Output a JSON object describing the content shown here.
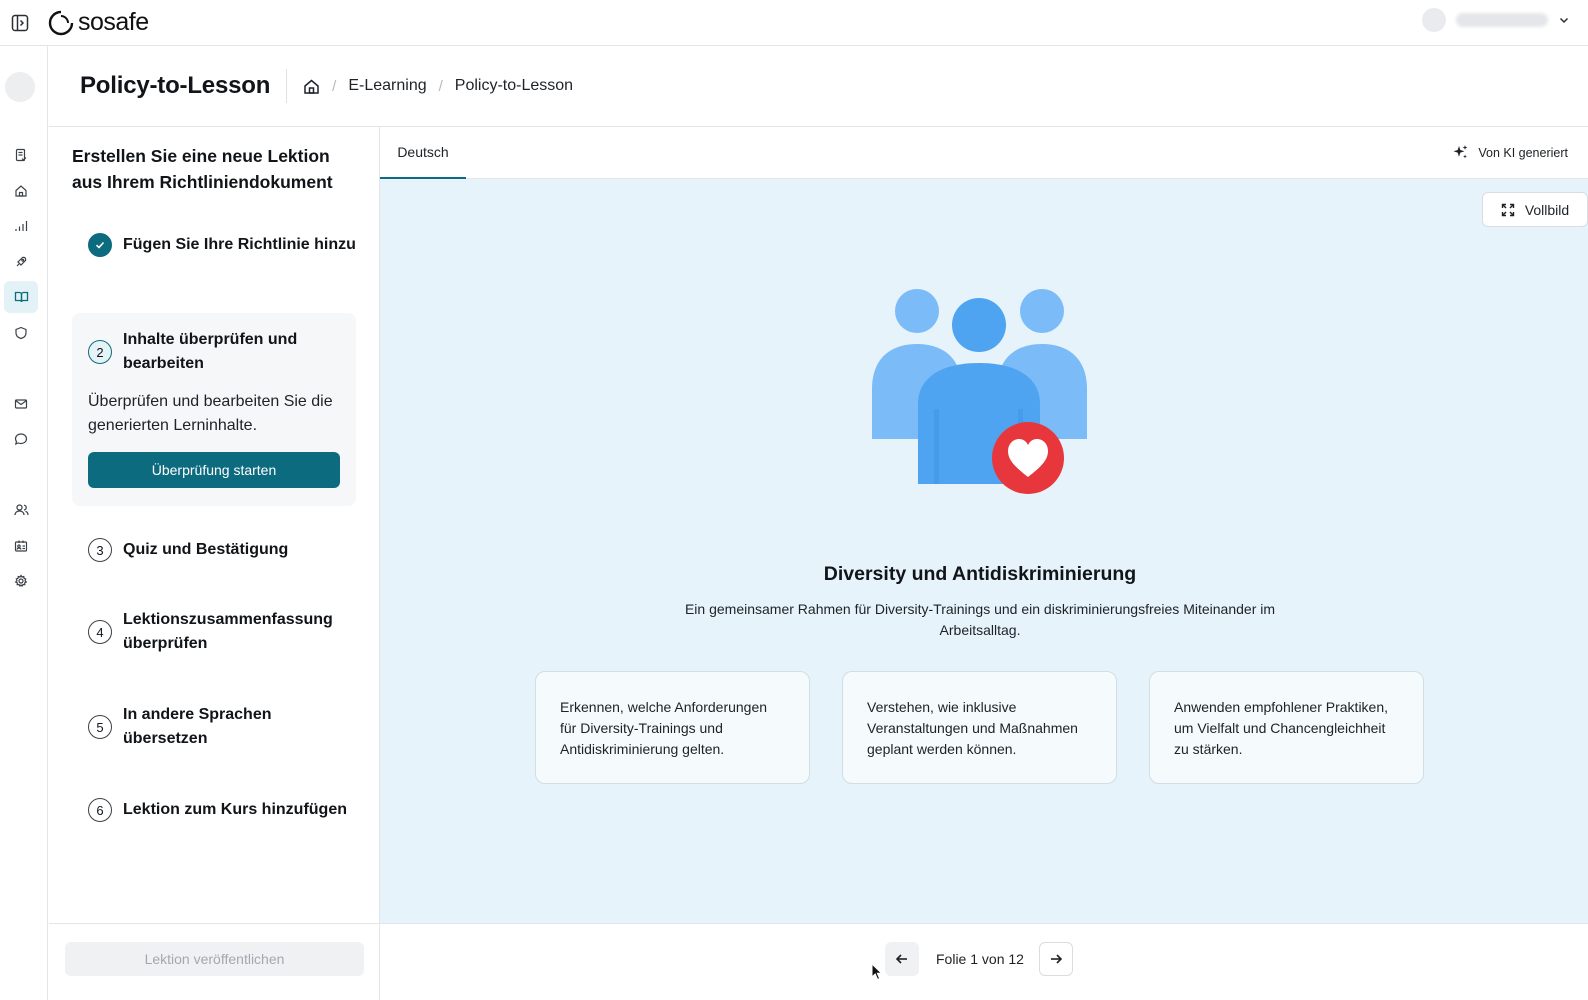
{
  "app": {
    "logo_text": "sosafe"
  },
  "header": {
    "title": "Policy-to-Lesson",
    "breadcrumb": [
      "E-Learning",
      "Policy-to-Lesson"
    ]
  },
  "steps": {
    "title": "Erstellen Sie eine neue Lektion aus Ihrem Richtliniendokument",
    "items": [
      {
        "num": "1",
        "label": "Fügen Sie Ihre Richtlinie hinzu",
        "state": "done"
      },
      {
        "num": "2",
        "label": "Inhalte überprüfen und bearbeiten",
        "state": "current",
        "description": "Überprüfen und bearbeiten Sie die generierten Lerninhalte.",
        "button": "Überprüfung starten"
      },
      {
        "num": "3",
        "label": "Quiz und Bestätigung",
        "state": "todo"
      },
      {
        "num": "4",
        "label": "Lektionszusammenfassung überprüfen",
        "state": "todo"
      },
      {
        "num": "5",
        "label": "In andere Sprachen übersetzen",
        "state": "todo"
      },
      {
        "num": "6",
        "label": "Lektion zum Kurs hinzufügen",
        "state": "todo"
      }
    ],
    "publish_button": "Lektion veröffentlichen"
  },
  "tabs": {
    "active": "Deutsch",
    "ai_label": "Von KI generiert"
  },
  "slide": {
    "fullscreen_label": "Vollbild",
    "title": "Diversity und Antidiskriminierung",
    "subtitle": "Ein gemeinsamer Rahmen für Diversity-Trainings und ein diskriminierungsfreies Miteinander im Arbeitsalltag.",
    "cards": [
      "Erkennen, welche Anforderungen für Diversity-Trainings und Antidiskriminierung gelten.",
      "Verstehen, wie inklusive Veranstaltungen und Maßnahmen geplant werden können.",
      "Anwenden empfohlener Praktiken, um Vielfalt und Chancengleichheit zu stärken."
    ]
  },
  "pager": {
    "text": "Folie 1 von 12"
  },
  "colors": {
    "accent": "#0d6b7f",
    "slide_bg": "#e6f3fb",
    "people": "#6fb4f5",
    "heart": "#e8363d"
  },
  "icons": {
    "rail": [
      "document-icon",
      "home-icon",
      "chart-icon",
      "rocket-icon",
      "book-icon",
      "shield-icon",
      "mail-icon",
      "chat-icon",
      "users-icon",
      "id-card-icon",
      "gear-icon"
    ]
  }
}
